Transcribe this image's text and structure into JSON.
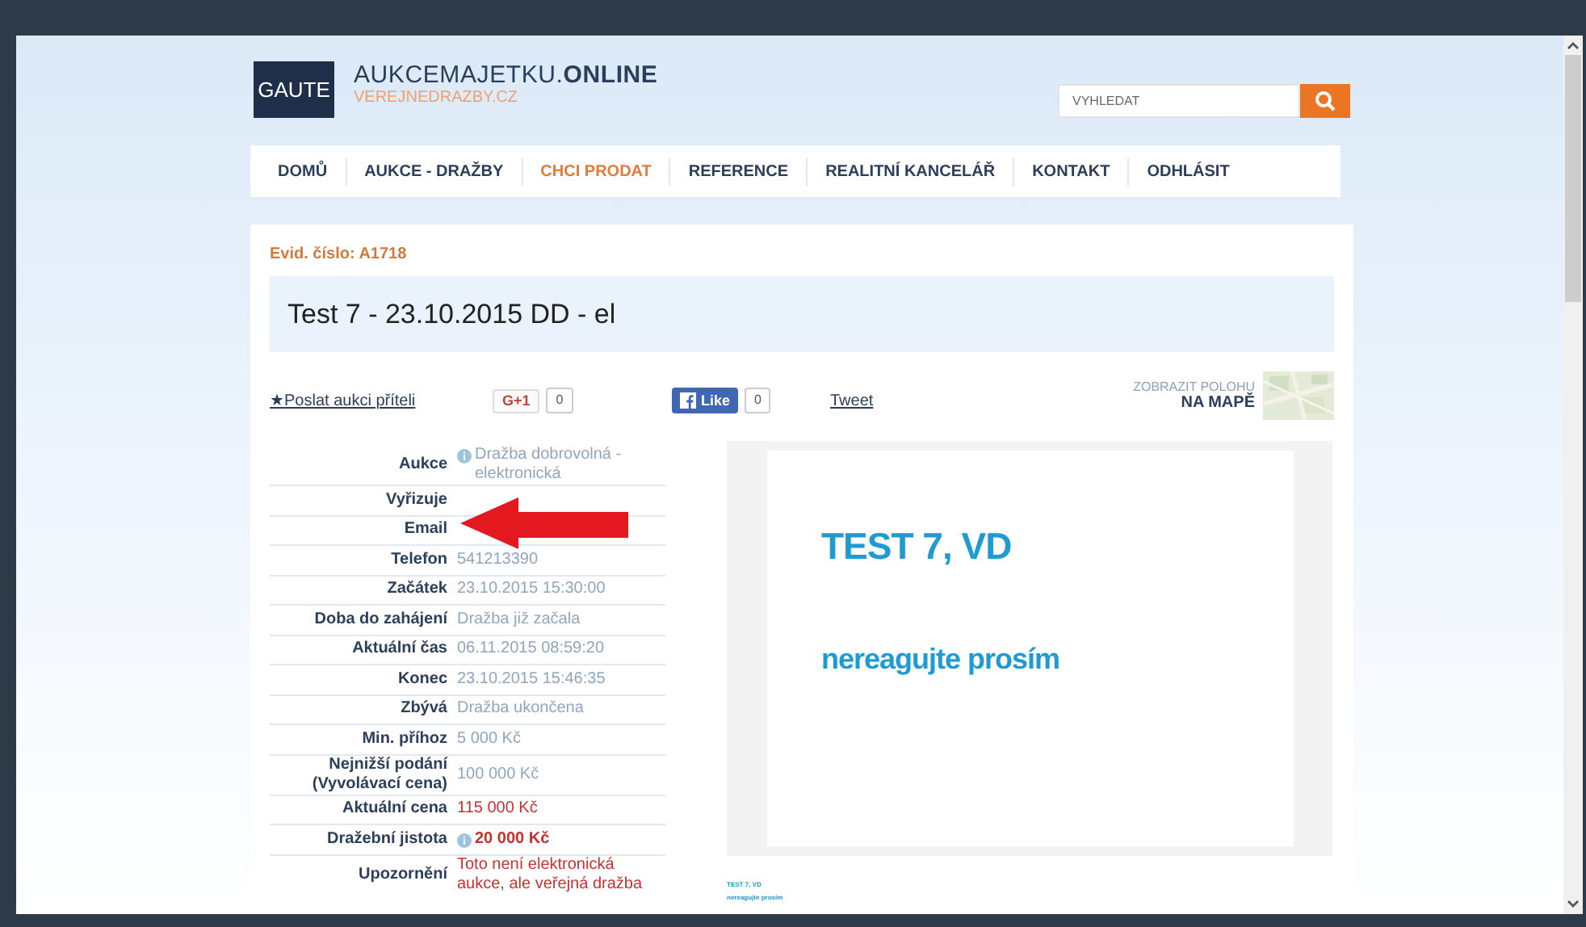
{
  "header": {
    "logo": "GAUTE",
    "brand": "AUKCEMAJETKU.**ONLINE**",
    "subbrand": "VEREJNEDRAZBY.CZ",
    "search": {
      "placeholder": "VYHLEDAT"
    }
  },
  "nav": [
    {
      "label": "DOMŮ",
      "selected": false
    },
    {
      "label": "AUKCE - DRAŽBY",
      "selected": false
    },
    {
      "label": "CHCI PRODAT",
      "selected": true
    },
    {
      "label": "REFERENCE",
      "selected": false
    },
    {
      "label": "REALITNÍ KANCELÁŘ",
      "selected": false
    },
    {
      "label": "KONTAKT",
      "selected": false
    },
    {
      "label": "ODHLÁSIT",
      "selected": false
    }
  ],
  "record": {
    "evid": "Evid. číslo: A1718",
    "title": "Test 7 - 23.10.2015 DD - el"
  },
  "social": {
    "send_link": "★Poslat aukci příteli",
    "gplus": {
      "label": "G+1",
      "count": "0"
    },
    "like": {
      "label": "Like",
      "count": "0"
    },
    "tweet": "Tweet",
    "map": {
      "line1": "ZOBRAZIT POLOHU",
      "line2": "NA MAPĚ"
    }
  },
  "details": [
    {
      "label": "Aukce",
      "value": "Dražba dobrovolná - elektronická",
      "kind": "plain",
      "info": true
    },
    {
      "label": "Vyřizuje",
      "info": false
    },
    {
      "label": "Email",
      "info": false
    },
    {
      "label": "Telefon",
      "value": "541213390",
      "kind": "plain",
      "info": false
    },
    {
      "label": "Začátek",
      "value": "23.10.2015 15:30:00",
      "kind": "plain",
      "info": false
    },
    {
      "label": "Doba do zahájení",
      "value": "Dražba již začala",
      "kind": "plain",
      "info": false
    },
    {
      "label": "Aktuální čas",
      "value": "06.11.2015 08:59:20",
      "kind": "plain",
      "info": false
    },
    {
      "label": "Konec",
      "value": "23.10.2015 15:46:35",
      "kind": "plain",
      "info": false
    },
    {
      "label": "Zbývá",
      "value": "Dražba ukončena",
      "kind": "plain",
      "info": false
    },
    {
      "label": "Min. příhoz",
      "value": "5 000 Kč",
      "kind": "plain",
      "info": false
    },
    {
      "label": "Nejnižší podání (Vyvolávací cena)",
      "value": "100 000 Kč",
      "kind": "plain",
      "info": false
    },
    {
      "label": "Aktuální cena",
      "value": "115 000 Kč",
      "kind": "price",
      "info": false
    },
    {
      "label": "Dražební jistota",
      "value": "20 000 Kč",
      "kind": "deposit",
      "info": true
    },
    {
      "label": "Upozornění",
      "value": "Toto není elektronická aukce, ale veřejná dražba",
      "kind": "warning",
      "info": false
    }
  ],
  "slide": {
    "heading": "TEST 7, VD",
    "subtitle": "nereagujte prosím"
  },
  "thumbnail": {
    "heading": "TEST 7, VD",
    "subtitle": "nereagujte prosím"
  }
}
